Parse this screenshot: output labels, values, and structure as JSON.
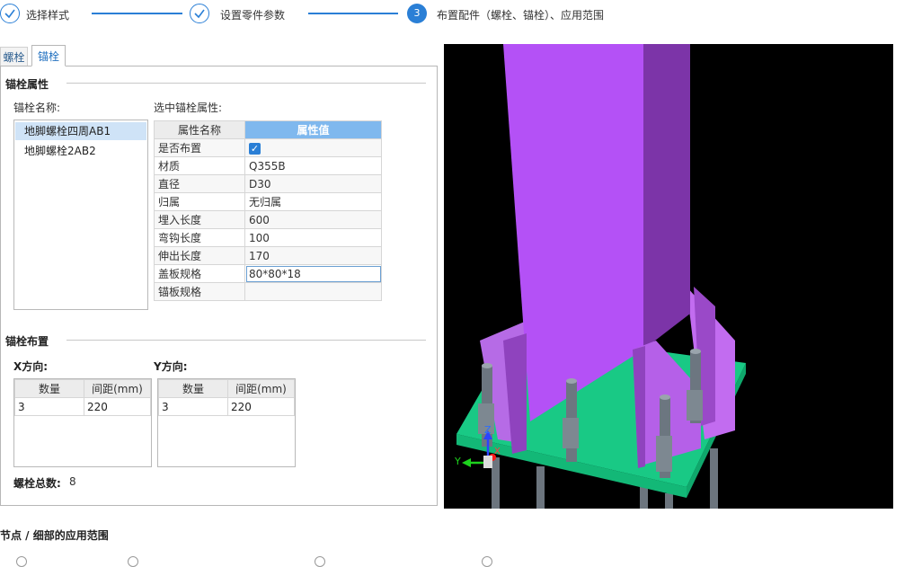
{
  "stepper": {
    "steps": [
      {
        "index": "",
        "label": "选择样式",
        "state": "done"
      },
      {
        "index": "",
        "label": "设置零件参数",
        "state": "done"
      },
      {
        "index": "3",
        "label": "布置配件（螺栓、锚栓）、应用范围",
        "state": "active"
      }
    ],
    "accent": "#2a7fd6"
  },
  "tabs": [
    {
      "label": "螺栓",
      "active": false
    },
    {
      "label": "锚栓",
      "active": true
    }
  ],
  "anchor_props": {
    "section_title": "锚栓属性",
    "name_label": "锚栓名称:",
    "names": [
      {
        "text": "地脚螺栓四周AB1",
        "selected": true
      },
      {
        "text": "地脚螺栓2AB2",
        "selected": false
      }
    ],
    "selected_label": "选中锚栓属性:",
    "col_name": "属性名称",
    "col_value": "属性值",
    "rows": [
      {
        "name": "是否布置",
        "value": "",
        "checkbox": true
      },
      {
        "name": "材质",
        "value": "Q355B"
      },
      {
        "name": "直径",
        "value": "D30"
      },
      {
        "name": "归属",
        "value": "无归属"
      },
      {
        "name": "埋入长度",
        "value": "600"
      },
      {
        "name": "弯钩长度",
        "value": "100"
      },
      {
        "name": "伸出长度",
        "value": "170"
      },
      {
        "name": "盖板规格",
        "value": "80*80*18",
        "editing": true
      },
      {
        "name": "锚板规格",
        "value": ""
      }
    ]
  },
  "layout": {
    "section_title": "锚栓布置",
    "x_label": "X方向:",
    "y_label": "Y方向:",
    "col_count": "数量",
    "col_spacing": "间距(mm)",
    "x_rows": [
      {
        "count": "3",
        "spacing": "220"
      }
    ],
    "y_rows": [
      {
        "count": "3",
        "spacing": "220"
      }
    ],
    "total_label": "螺栓总数:",
    "total_value": "8"
  },
  "scope": {
    "title": "节点 / 细部的应用范围"
  },
  "viewport": {
    "axis_x": "X",
    "axis_y": "Y",
    "axis_z": "Z",
    "column_color": "#b04ef2",
    "plate_color": "#17c27c",
    "bolt_color": "#707a84"
  }
}
